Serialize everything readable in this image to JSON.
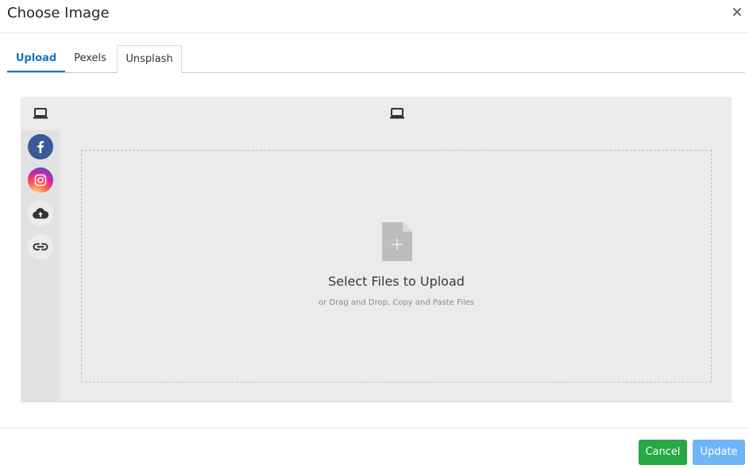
{
  "dialog": {
    "title": "Choose Image",
    "close_label": "×"
  },
  "tabs": [
    {
      "label": "Upload",
      "active": true
    },
    {
      "label": "Pexels",
      "active": false
    },
    {
      "label": "Unsplash",
      "active": false
    }
  ],
  "sources": [
    {
      "icon": "computer-icon",
      "name": "My Device"
    },
    {
      "icon": "facebook-icon",
      "name": "Facebook"
    },
    {
      "icon": "instagram-icon",
      "name": "Instagram"
    },
    {
      "icon": "cloud-upload-icon",
      "name": "Cloud"
    },
    {
      "icon": "link-icon",
      "name": "Link"
    }
  ],
  "dropzone": {
    "title": "Select Files to Upload",
    "subtitle": "or Drag and Drop, Copy and Paste Files"
  },
  "footer": {
    "cancel_label": "Cancel",
    "update_label": "Update"
  },
  "colors": {
    "accent": "#1a73c7",
    "cancel": "#28a745",
    "update": "#6fb5f7",
    "facebook": "#3b5998"
  }
}
